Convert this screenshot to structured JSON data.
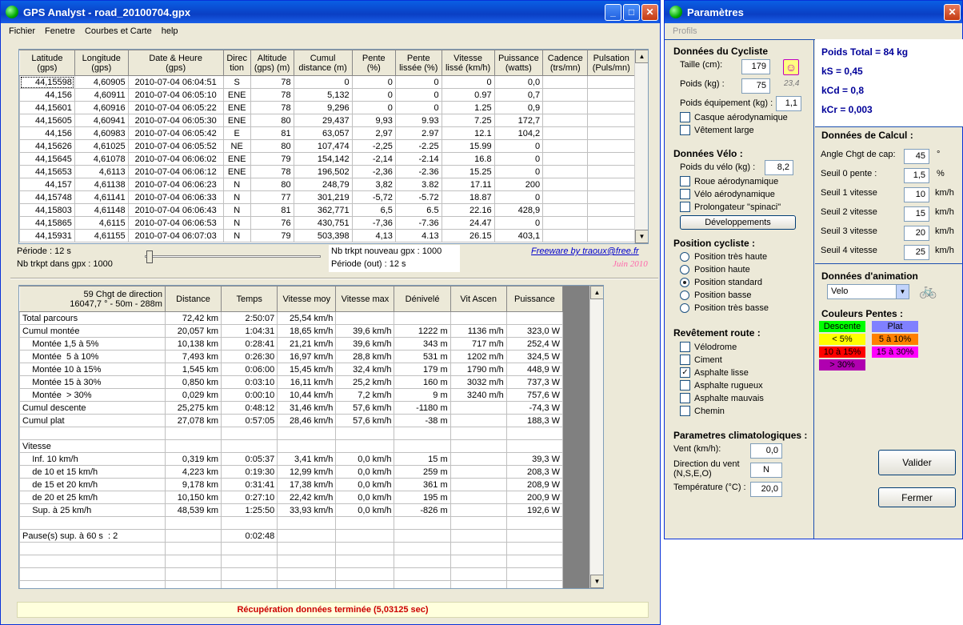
{
  "main": {
    "title": "GPS Analyst - road_20100704.gpx",
    "menu": [
      "Fichier",
      "Fenetre",
      "Courbes et Carte",
      "help"
    ],
    "track_headers": [
      "Latitude\n(gps)",
      "Longitude\n(gps)",
      "Date & Heure\n(gps)",
      "Direc\ntion",
      "Altitude\n(gps) (m)",
      "Cumul\ndistance (m)",
      "Pente\n(%)",
      "Pente\nlissée (%)",
      "Vitesse\nlissé (km/h)",
      "Puissance\n(watts)",
      "Cadence\n(trs/mn)",
      "Pulsation\n(Puls/mn)"
    ],
    "track_rows": [
      [
        "44,15598",
        "4,60905",
        "2010-07-04 06:04:51",
        "S",
        "78",
        "0",
        "0",
        "0",
        "0",
        "0,0",
        "",
        ""
      ],
      [
        "44,156",
        "4,60911",
        "2010-07-04 06:05:10",
        "ENE",
        "78",
        "5,132",
        "0",
        "0",
        "0.97",
        "0,7",
        "",
        ""
      ],
      [
        "44,15601",
        "4,60916",
        "2010-07-04 06:05:22",
        "ENE",
        "78",
        "9,296",
        "0",
        "0",
        "1.25",
        "0,9",
        "",
        ""
      ],
      [
        "44,15605",
        "4,60941",
        "2010-07-04 06:05:30",
        "ENE",
        "80",
        "29,437",
        "9,93",
        "9.93",
        "7.25",
        "172,7",
        "",
        ""
      ],
      [
        "44,156",
        "4,60983",
        "2010-07-04 06:05:42",
        "E",
        "81",
        "63,057",
        "2,97",
        "2.97",
        "12.1",
        "104,2",
        "",
        ""
      ],
      [
        "44,15626",
        "4,61025",
        "2010-07-04 06:05:52",
        "NE",
        "80",
        "107,474",
        "-2,25",
        "-2.25",
        "15.99",
        "0",
        "",
        ""
      ],
      [
        "44,15645",
        "4,61078",
        "2010-07-04 06:06:02",
        "ENE",
        "79",
        "154,142",
        "-2,14",
        "-2.14",
        "16.8",
        "0",
        "",
        ""
      ],
      [
        "44,15653",
        "4,6113",
        "2010-07-04 06:06:12",
        "ENE",
        "78",
        "196,502",
        "-2,36",
        "-2.36",
        "15.25",
        "0",
        "",
        ""
      ],
      [
        "44,157",
        "4,61138",
        "2010-07-04 06:06:23",
        "N",
        "80",
        "248,79",
        "3,82",
        "3.82",
        "17.11",
        "200",
        "",
        ""
      ],
      [
        "44,15748",
        "4,61141",
        "2010-07-04 06:06:33",
        "N",
        "77",
        "301,219",
        "-5,72",
        "-5.72",
        "18.87",
        "0",
        "",
        ""
      ],
      [
        "44,15803",
        "4,61148",
        "2010-07-04 06:06:43",
        "N",
        "81",
        "362,771",
        "6,5",
        "6.5",
        "22.16",
        "428,9",
        "",
        ""
      ],
      [
        "44,15865",
        "4,6115",
        "2010-07-04 06:06:53",
        "N",
        "76",
        "430,751",
        "-7,36",
        "-7.36",
        "24.47",
        "0",
        "",
        ""
      ],
      [
        "44,15931",
        "4,61155",
        "2010-07-04 06:07:03",
        "N",
        "79",
        "503,398",
        "4,13",
        "4.13",
        "26.15",
        "403,1",
        "",
        ""
      ]
    ],
    "periode": "Période : 12 s",
    "nb_trkpt": "Nb trkpt dans gpx : 1000",
    "nb_trkpt_new": "Nb trkpt nouveau gpx : 1000",
    "periode_out": "Période (out) : 12 s",
    "freeware": "Freeware by traoux@free.fr",
    "juin": "Juin 2010",
    "stats_header_first": "59 Chgt de direction\n16047,7 ° - 50m - 288m",
    "stats_headers": [
      "Distance",
      "Temps",
      "Vitesse moy",
      "Vitesse max",
      "Dénivelé",
      "Vit Ascen",
      "Puissance"
    ],
    "stats_rows": [
      [
        "Total parcours",
        "72,42 km",
        "2:50:07",
        "25,54 km/h",
        "",
        "",
        "",
        ""
      ],
      [
        "Cumul montée",
        "20,057 km",
        "1:04:31",
        "18,65 km/h",
        "39,6 km/h",
        "1222 m",
        "1136 m/h",
        "323,0 W"
      ],
      [
        "    Montée 1,5 à 5%",
        "10,138 km",
        "0:28:41",
        "21,21 km/h",
        "39,6 km/h",
        "343 m",
        "717 m/h",
        "252,4 W"
      ],
      [
        "    Montée  5 à 10%",
        "7,493 km",
        "0:26:30",
        "16,97 km/h",
        "28,8 km/h",
        "531 m",
        "1202 m/h",
        "324,5 W"
      ],
      [
        "    Montée 10 à 15%",
        "1,545 km",
        "0:06:00",
        "15,45 km/h",
        "32,4 km/h",
        "179 m",
        "1790 m/h",
        "448,9 W"
      ],
      [
        "    Montée 15 à 30%",
        "0,850 km",
        "0:03:10",
        "16,11 km/h",
        "25,2 km/h",
        "160 m",
        "3032 m/h",
        "737,3 W"
      ],
      [
        "    Montée  > 30%",
        "0,029 km",
        "0:00:10",
        "10,44 km/h",
        "7,2 km/h",
        "9 m",
        "3240 m/h",
        "757,6 W"
      ],
      [
        "Cumul descente",
        "25,275 km",
        "0:48:12",
        "31,46 km/h",
        "57,6 km/h",
        "-1180 m",
        "",
        "-74,3 W"
      ],
      [
        "Cumul plat",
        "27,078 km",
        "0:57:05",
        "28,46 km/h",
        "57,6 km/h",
        "-38 m",
        "",
        "188,3 W"
      ],
      [
        "",
        "",
        "",
        "",
        "",
        "",
        "",
        ""
      ],
      [
        "Vitesse",
        "",
        "",
        "",
        "",
        "",
        "",
        ""
      ],
      [
        "    Inf. 10 km/h",
        "0,319 km",
        "0:05:37",
        "3,41 km/h",
        "0,0 km/h",
        "15 m",
        "",
        "39,3 W"
      ],
      [
        "    de 10 et 15 km/h",
        "4,223 km",
        "0:19:30",
        "12,99 km/h",
        "0,0 km/h",
        "259 m",
        "",
        "208,3 W"
      ],
      [
        "    de 15 et 20 km/h",
        "9,178 km",
        "0:31:41",
        "17,38 km/h",
        "0,0 km/h",
        "361 m",
        "",
        "208,9 W"
      ],
      [
        "    de 20 et 25 km/h",
        "10,150 km",
        "0:27:10",
        "22,42 km/h",
        "0,0 km/h",
        "195 m",
        "",
        "200,9 W"
      ],
      [
        "    Sup. à 25 km/h",
        "48,539 km",
        "1:25:50",
        "33,93 km/h",
        "0,0 km/h",
        "-826 m",
        "",
        "192,6 W"
      ],
      [
        "",
        "",
        "",
        "",
        "",
        "",
        "",
        ""
      ],
      [
        "Pause(s) sup. à 60 s  : 2",
        "",
        "0:02:48",
        "",
        "",
        "",
        "",
        ""
      ],
      [
        "",
        "",
        "",
        "",
        "",
        "",
        "",
        ""
      ],
      [
        "",
        "",
        "",
        "",
        "",
        "",
        "",
        ""
      ],
      [
        "",
        "",
        "",
        "",
        "",
        "",
        "",
        ""
      ],
      [
        "",
        "",
        "",
        "",
        "",
        "",
        "",
        ""
      ]
    ],
    "status": "Récupération données terminée (5,03125 sec)"
  },
  "params": {
    "title": "Paramètres",
    "menu": "Profils",
    "cycliste_title": "Données du Cycliste",
    "taille_label": "Taille (cm):",
    "taille": "179",
    "poids_label": "Poids (kg) :",
    "poids": "75",
    "bmi": "23,4",
    "poids_equip_label": "Poids équipement (kg) :",
    "poids_equip": "1,1",
    "casque": "Casque aérodynamique",
    "vetement": "Vêtement large",
    "velo_title": "Données Vélo :",
    "poids_velo_label": "Poids du vélo (kg) :",
    "poids_velo": "8,2",
    "roue": "Roue aérodynamique",
    "velo_aero": "Vélo aérodynamique",
    "prolongateur": "Prolongateur \"spinaci\"",
    "developpements": "Développements",
    "position_title": "Position cycliste :",
    "positions": [
      "Position très haute",
      "Position haute",
      "Position standard",
      "Position basse",
      "Position très basse"
    ],
    "revetement_title": "Revêtement route :",
    "revetements": [
      "Vélodrome",
      "Ciment",
      "Asphalte lisse",
      "Asphalte rugueux",
      "Asphalte mauvais",
      "Chemin"
    ],
    "clima_title": "Parametres climatologiques :",
    "vent_label": "Vent (km/h):",
    "vent": "0,0",
    "dir_vent_label": "Direction du vent\n(N,S,E,O)",
    "dir_vent": "N",
    "temp_label": "Température (°C) :",
    "temp": "20,0",
    "poids_total": "Poids Total = 84 kg",
    "ks": "kS = 0,45",
    "kcd": "kCd = 0,8",
    "kcr": "kCr = 0,003",
    "calcul_title": "Données de Calcul :",
    "angle_label": "Angle Chgt  de cap:",
    "angle": "45",
    "angle_unit": "°",
    "seuil0_label": "Seuil 0 pente :",
    "seuil0": "1,5",
    "seuil0_unit": "%",
    "seuil1_label": "Seuil 1 vitesse",
    "seuil1": "10",
    "seuil2_label": "Seuil 2 vitesse",
    "seuil2": "15",
    "seuil3_label": "Seuil 3 vitesse",
    "seuil3": "20",
    "seuil4_label": "Seuil 4 vitesse",
    "seuil4": "25",
    "kmh": "km/h",
    "anim_title": "Données d'animation",
    "anim_select": "Velo",
    "couleurs_title": "Couleurs Pentes :",
    "couleurs": [
      {
        "label": "Descente",
        "color": "#00ff00",
        "fg": "#000"
      },
      {
        "label": "Plat",
        "color": "#8080ff",
        "fg": "#000"
      },
      {
        "label": "< 5%",
        "color": "#ffff00",
        "fg": "#000"
      },
      {
        "label": "5 à 10%",
        "color": "#ff8000",
        "fg": "#000"
      },
      {
        "label": "10 à 15%",
        "color": "#ff0000",
        "fg": "#000"
      },
      {
        "label": "15 à 30%",
        "color": "#ff00ff",
        "fg": "#000"
      },
      {
        "label": "> 30%",
        "color": "#b000b0",
        "fg": "#000"
      }
    ],
    "valider": "Valider",
    "fermer": "Fermer"
  }
}
